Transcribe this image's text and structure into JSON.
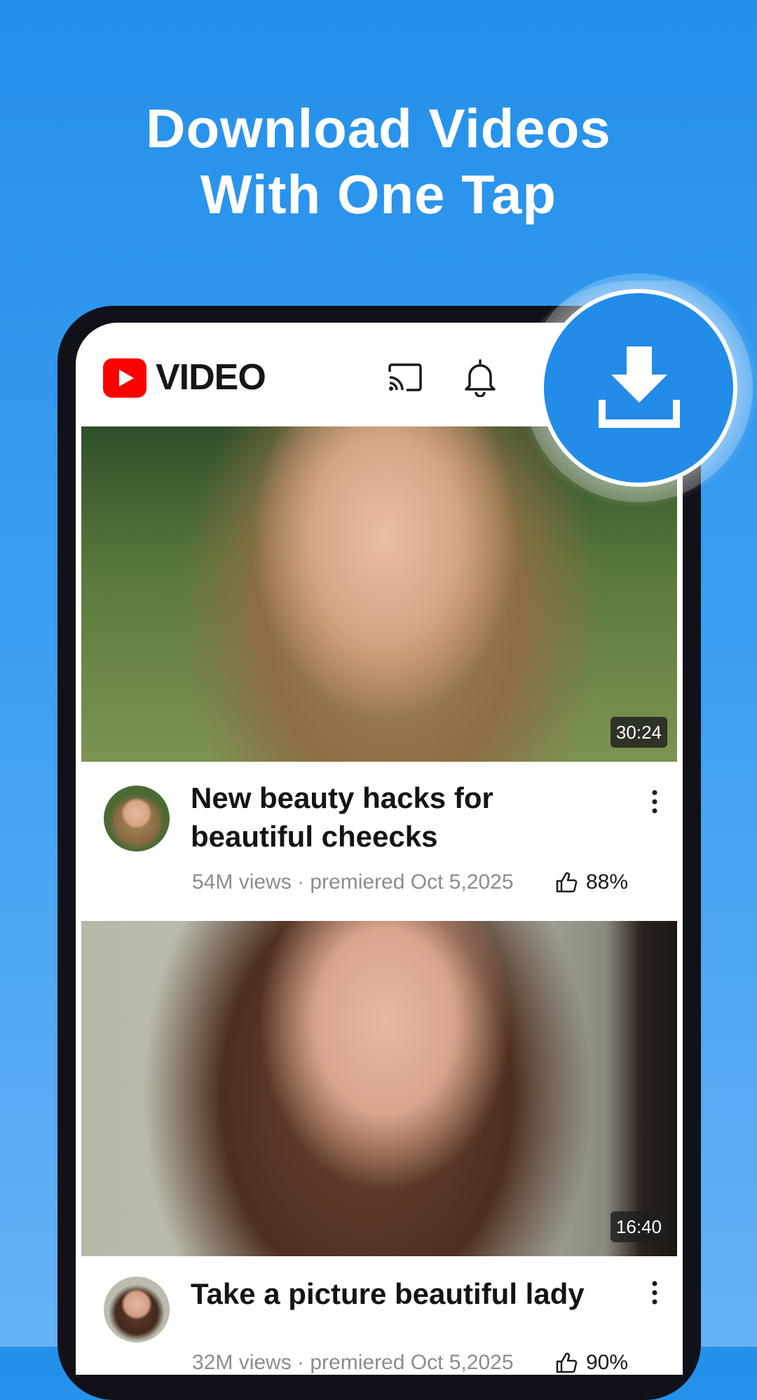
{
  "headline": {
    "line1": "Download Videos",
    "line2": "With One Tap"
  },
  "app": {
    "name": "VIDEO",
    "icons": [
      "play-logo-icon",
      "cast-icon",
      "bell-icon",
      "download-icon"
    ]
  },
  "videos": [
    {
      "duration": "30:24",
      "title": "New beauty hacks for beautiful cheecks",
      "meta": "54M views · premiered Oct 5,2025",
      "rating": "88%"
    },
    {
      "duration": "16:40",
      "title": "Take a picture beautiful lady",
      "meta": "32M views · premiered Oct 5,2025",
      "rating": "90%"
    }
  ],
  "colors": {
    "background": "#2490ea",
    "accent": "#238ce8",
    "logo_red": "#ff0000",
    "phone_frame": "#111119"
  }
}
